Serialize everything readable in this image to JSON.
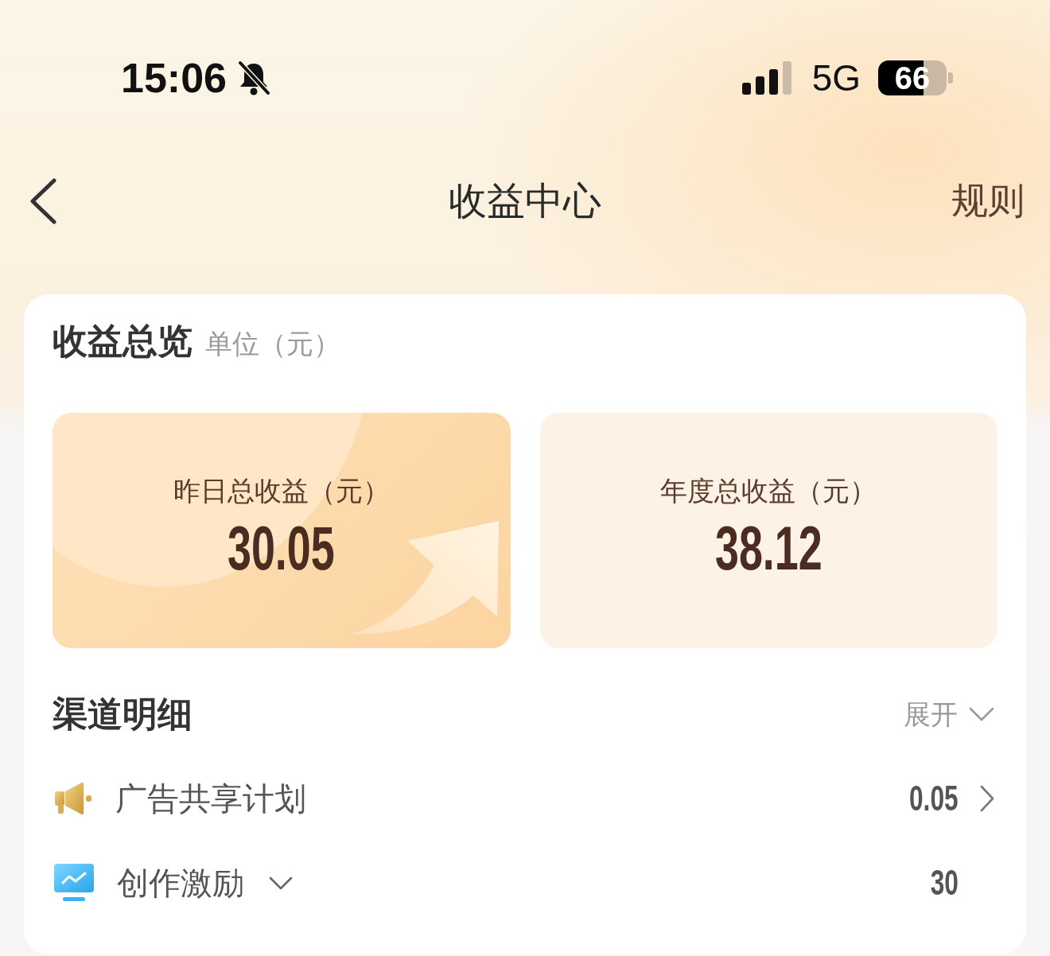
{
  "status_bar": {
    "time": "15:06",
    "network": "5G",
    "battery": "66"
  },
  "nav_bar": {
    "title": "收益中心",
    "action": "规则"
  },
  "overview": {
    "title": "收益总览",
    "unit": "单位（元）",
    "tiles": [
      {
        "kind": "featured",
        "label": "昨日总收益（元）",
        "value": "30.05"
      },
      {
        "kind": "plain",
        "label": "年度总收益（元）",
        "value": "38.12"
      }
    ]
  },
  "channels": {
    "title": "渠道明细",
    "toggle": "展开",
    "items": [
      {
        "kind": "link",
        "name": "广告共享计划",
        "value": "0.05"
      },
      {
        "kind": "expandable",
        "name": "创作激励",
        "value": "30",
        "expanded": false
      }
    ]
  }
}
